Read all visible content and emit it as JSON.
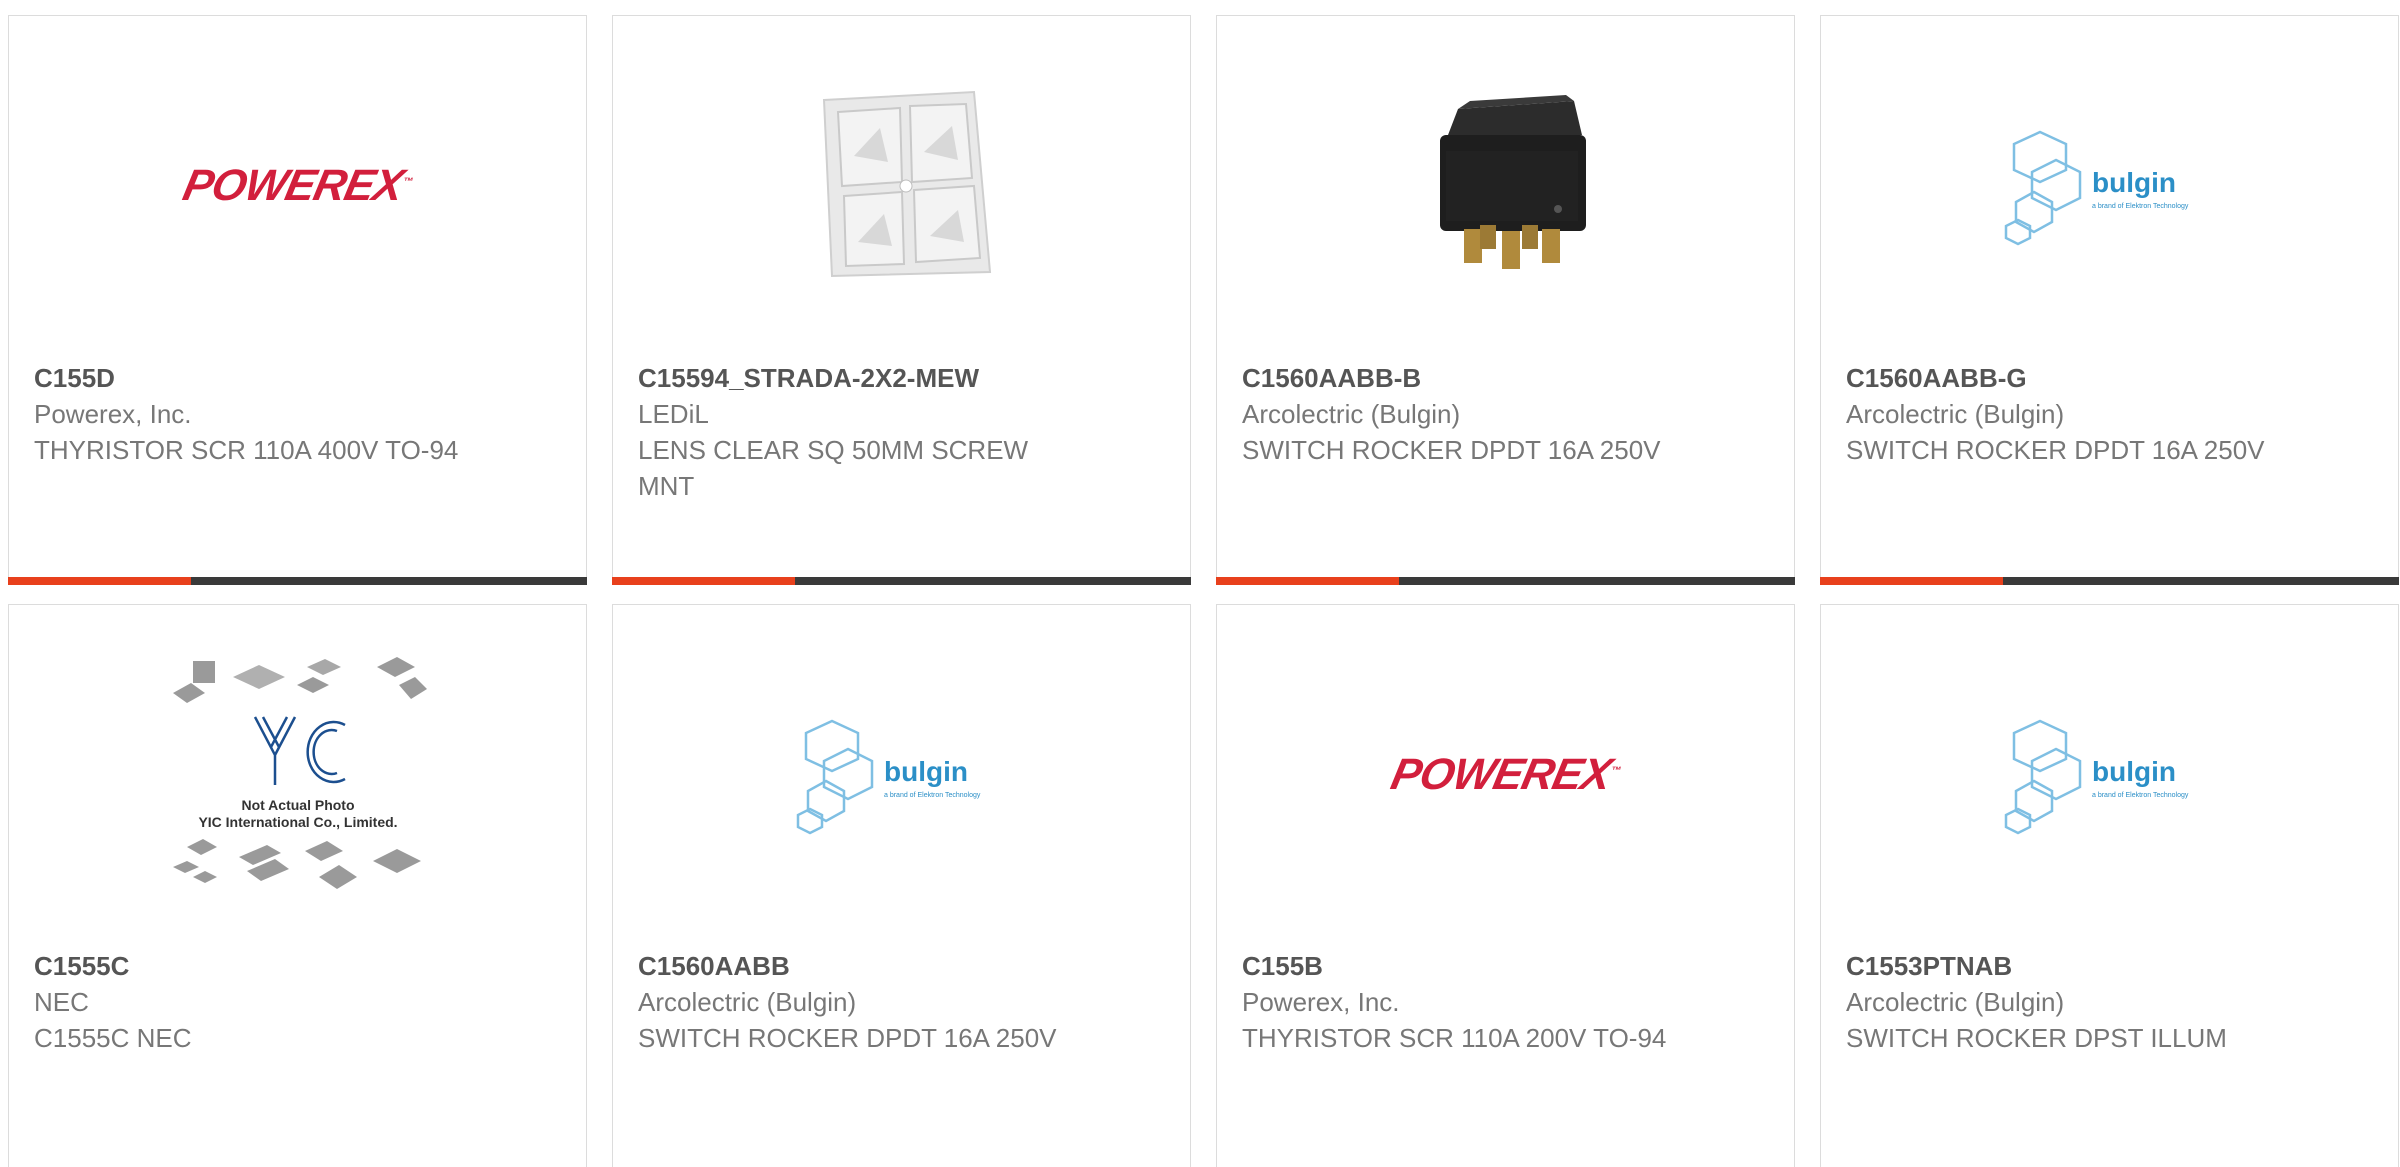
{
  "colors": {
    "accent": "#e8401c",
    "bar_dark": "#3a3a3a",
    "powerex_red": "#d21f3c",
    "bulgin_blue": "#2b8fc7"
  },
  "cards": [
    {
      "image": "powerex-logo",
      "logo_text": "POWEREX",
      "part": "C155D",
      "manufacturer": "Powerex, Inc.",
      "description": "THYRISTOR SCR 110A 400V TO-94"
    },
    {
      "image": "lens-photo",
      "part": "C15594_STRADA-2X2-MEW",
      "manufacturer": "LEDiL",
      "description": "LENS CLEAR SQ 50MM SCREW MNT"
    },
    {
      "image": "rocker-switch-photo",
      "part": "C1560AABB-B",
      "manufacturer": "Arcolectric (Bulgin)",
      "description": "SWITCH ROCKER DPDT 16A 250V"
    },
    {
      "image": "bulgin-logo",
      "logo_text": "bulgin",
      "logo_sub": "a brand of Elektron Technology",
      "part": "C1560AABB-G",
      "manufacturer": "Arcolectric (Bulgin)",
      "description": "SWITCH ROCKER DPDT 16A 250V"
    },
    {
      "image": "yic-placeholder",
      "logo_text": "YIC",
      "placeholder_line1": "Not Actual Photo",
      "placeholder_line2": "YIC International Co., Limited.",
      "part": "C1555C",
      "manufacturer": "NEC",
      "description": "C1555C NEC"
    },
    {
      "image": "bulgin-logo",
      "logo_text": "bulgin",
      "logo_sub": "a brand of Elektron Technology",
      "part": "C1560AABB",
      "manufacturer": "Arcolectric (Bulgin)",
      "description": "SWITCH ROCKER DPDT 16A 250V"
    },
    {
      "image": "powerex-logo",
      "logo_text": "POWEREX",
      "part": "C155B",
      "manufacturer": "Powerex, Inc.",
      "description": "THYRISTOR SCR 110A 200V TO-94"
    },
    {
      "image": "bulgin-logo",
      "logo_text": "bulgin",
      "logo_sub": "a brand of Elektron Technology",
      "part": "C1553PTNAB",
      "manufacturer": "Arcolectric (Bulgin)",
      "description": "SWITCH ROCKER DPST ILLUM"
    }
  ]
}
